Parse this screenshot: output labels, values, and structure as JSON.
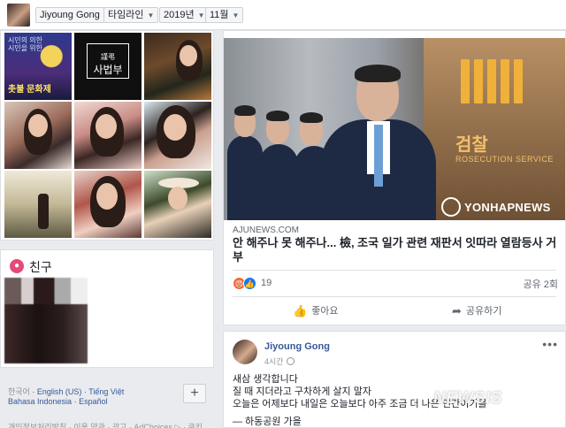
{
  "header": {
    "profile_name": "Jiyoung Gong",
    "section": "타임라인",
    "year": "2019년",
    "month": "11월"
  },
  "photos": {
    "p1_line1": "시민의 의한",
    "p1_line2": "시민을 위한",
    "p1_line3": "촛불 문화제",
    "p2_line1": "謹弔",
    "p2_line2": "사법부"
  },
  "friends": {
    "title": "친구"
  },
  "languages": {
    "current": "한국어",
    "en": "English (US)",
    "vi": "Tiếng Việt",
    "id": "Bahasa Indonesia",
    "es": "Español",
    "plus": "+"
  },
  "footer": {
    "links": "개인정보처리방침 · 이용 약관 · 광고 · AdChoices ▷ · 쿠키"
  },
  "news": {
    "source": "AJUNEWS.COM",
    "title": "안 해주나 못 해주나... 檢, 조국 일가 관련 재판서 잇따라 열람등사 거부",
    "image_hanja": "검찰",
    "image_text": "ROSECUTION SERVICE",
    "image_credit": "YONHAPNEWS",
    "reaction_count": "19",
    "share_count": "공유 2회",
    "like_label": "좋아요",
    "share_label": "공유하기"
  },
  "post": {
    "author": "Jiyoung Gong",
    "time": "4시간",
    "more": "•••",
    "line1": "새삼 생각합니다",
    "line2": "질 때 지더라고 구차하게 살지 말자",
    "line3": "오늘은 어제보다 내일은 오늘보다 아주 조금 더 나은 인간이기를",
    "line4": "— 하동공원 가을"
  },
  "watermark": "NEWSIS",
  "colors": {
    "page_bg": "#e9ebee",
    "link_blue": "#385898",
    "like_blue": "#1877f2",
    "angry_orange": "#f06b3d",
    "friends_pink": "#e64a7a"
  },
  "icons": [
    "friends-icon",
    "angry-reaction-icon",
    "like-reaction-icon",
    "like-icon",
    "share-icon",
    "globe-icon",
    "more-options-icon",
    "add-language-icon",
    "chevron-down-icon"
  ]
}
